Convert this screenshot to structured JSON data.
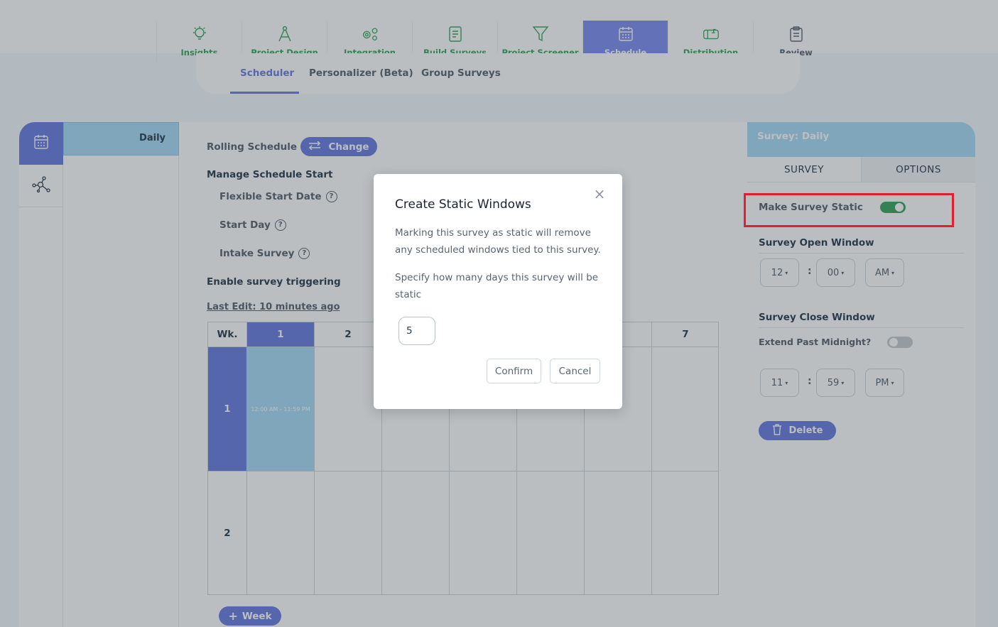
{
  "nav": {
    "tabs": [
      {
        "label": "Insights",
        "icon": "lightbulb-icon"
      },
      {
        "label": "Project Design",
        "icon": "compass-icon"
      },
      {
        "label": "Integration",
        "icon": "gears-icon"
      },
      {
        "label": "Build Surveys",
        "icon": "document-icon"
      },
      {
        "label": "Project Screener",
        "icon": "filter-icon"
      },
      {
        "label": "Schedule",
        "icon": "calendar-icon"
      },
      {
        "label": "Distribution",
        "icon": "mailbox-icon"
      },
      {
        "label": "Review",
        "icon": "clipboard-icon"
      }
    ],
    "active": "Schedule"
  },
  "subtabs": {
    "items": [
      "Scheduler",
      "Personalizer (Beta)",
      "Group Surveys"
    ],
    "active": "Scheduler"
  },
  "left_list": {
    "items": [
      "Daily"
    ]
  },
  "main": {
    "rolling_schedule": "Rolling Schedule",
    "change_label": "Change",
    "manage_start": "Manage Schedule Start",
    "flexible_start": "Flexible Start Date",
    "start_day": "Start Day",
    "intake_survey": "Intake Survey",
    "enable_triggering": "Enable survey triggering",
    "last_edit": "Last Edit: 10 minutes ago",
    "grid": {
      "corner": "Wk.",
      "visible_headers": [
        "1",
        "2",
        "7"
      ],
      "weeks": [
        "1",
        "2"
      ],
      "slot_text": "12:00 AM - 11:59 PM"
    },
    "add_week_label": "Week"
  },
  "right_panel": {
    "title": "Survey: Daily",
    "tabs": [
      "SURVEY",
      "OPTIONS"
    ],
    "make_static_label": "Make Survey Static",
    "make_static_on": true,
    "open_window_label": "Survey Open Window",
    "open": {
      "hour": "12",
      "minute": "00",
      "ampm": "AM"
    },
    "close_window_label": "Survey Close Window",
    "extend_label": "Extend Past Midnight?",
    "extend_on": false,
    "close": {
      "hour": "11",
      "minute": "59",
      "ampm": "PM"
    },
    "delete_label": "Delete"
  },
  "modal": {
    "title": "Create Static Windows",
    "close_glyph": "×",
    "text1": "Marking this survey as static will remove any scheduled windows tied to this survey.",
    "text2": "Specify how many days this survey will be static",
    "days_value": "5",
    "confirm_label": "Confirm",
    "cancel_label": "Cancel"
  },
  "colors": {
    "accent": "#6c7ee0",
    "nav_green": "#3aa65e",
    "light_blue": "#a9dcf7",
    "highlight_red": "#e0202e",
    "toggle_on": "#3aa65e"
  }
}
